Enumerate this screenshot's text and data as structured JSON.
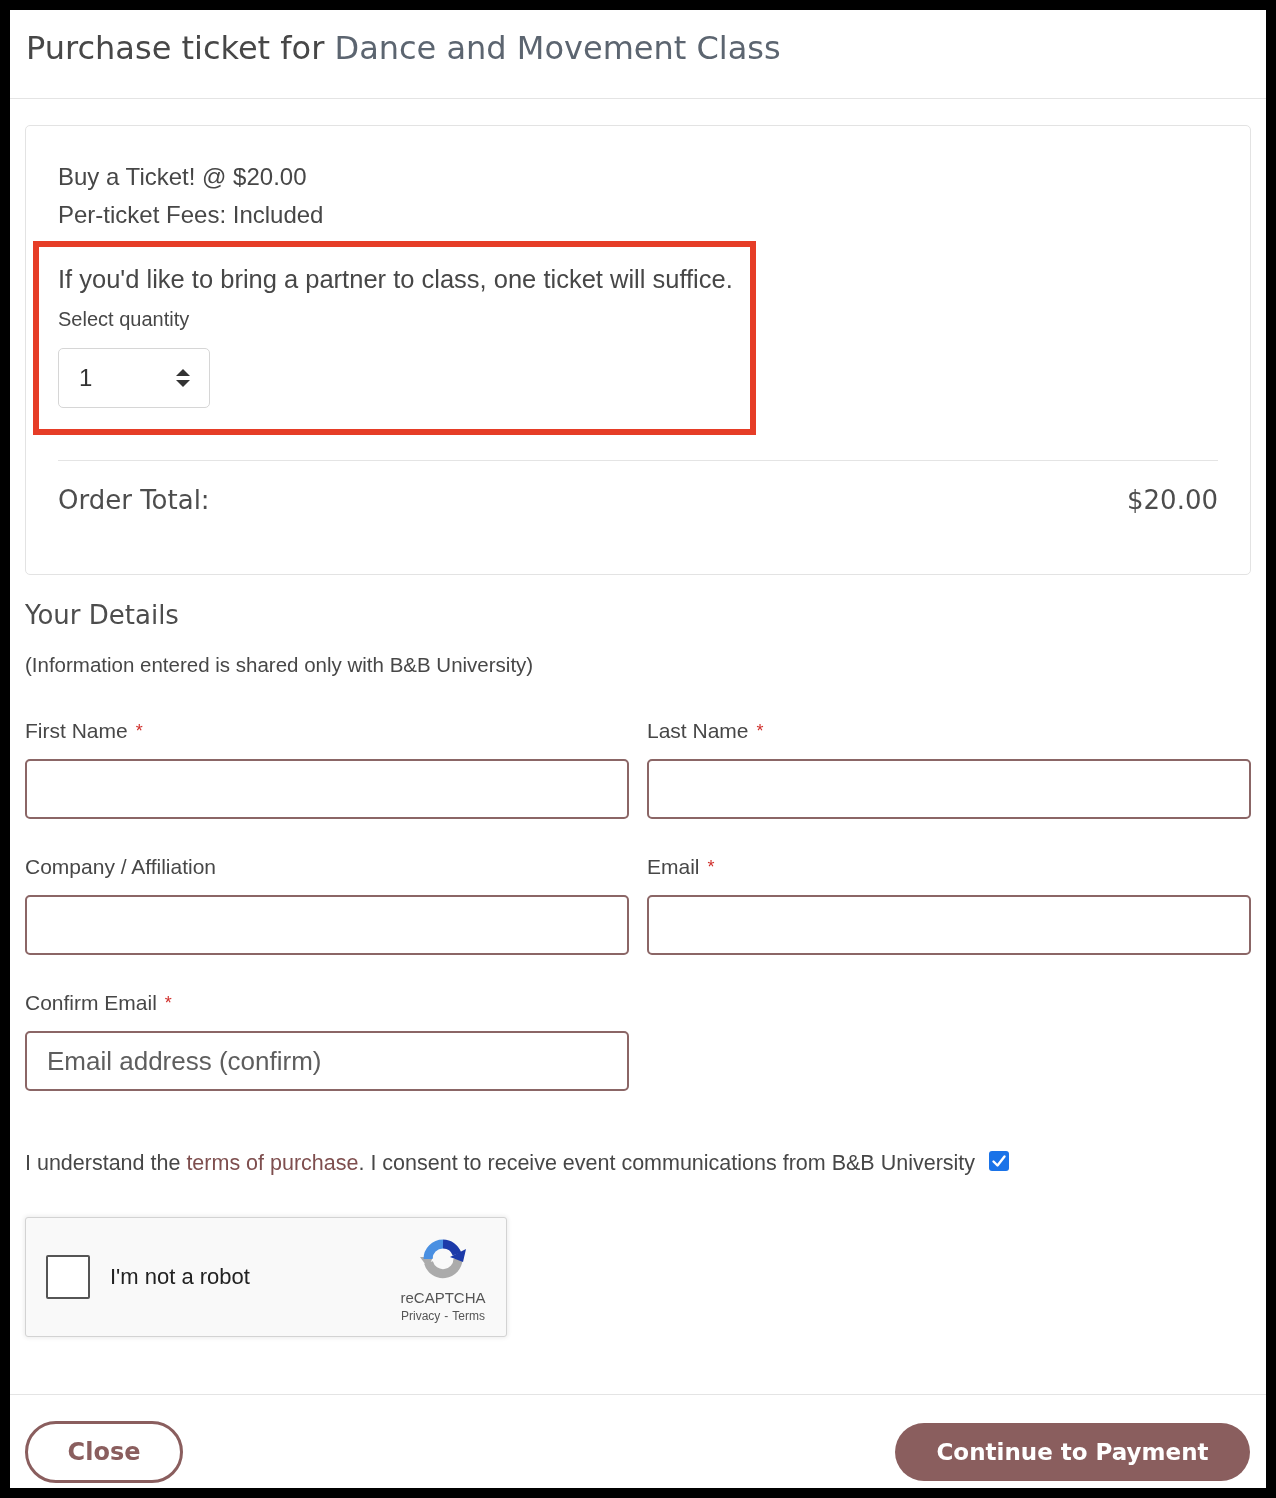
{
  "dialog": {
    "title_prefix": "Purchase ticket for",
    "event_name": "Dance and Movement Class"
  },
  "ticket": {
    "name_price": "Buy a Ticket! @ $20.00",
    "fees": "Per-ticket Fees: Included",
    "quantity_section": {
      "highlighted": true,
      "note": "If you'd like to bring a partner to class, one ticket will suffice.",
      "label": "Select quantity",
      "value": "1"
    },
    "order_total": {
      "label": "Order Total:",
      "value": "$20.00"
    }
  },
  "details": {
    "heading": "Your Details",
    "note": "(Information entered is shared only with B&B University)",
    "fields": [
      {
        "label": "First Name",
        "required_mark": "*"
      },
      {
        "label": "Last Name",
        "required_mark": "*"
      },
      {
        "label": "Company / Affiliation"
      },
      {
        "label": "Email",
        "required_mark": "*"
      },
      {
        "label": "Confirm Email",
        "required_mark": "*",
        "placeholder": "Email address (confirm)"
      }
    ]
  },
  "consent": {
    "text_before": "I understand the",
    "link": "terms of purchase",
    "text_after": ". I consent to receive event communications from B&B University",
    "checked": true
  },
  "captcha": {
    "label": "I'm not a robot",
    "checked": false,
    "brand": "reCAPTCHA",
    "links": [
      "Privacy",
      "Terms"
    ],
    "separator": "-"
  },
  "footer": {
    "buttons": [
      {
        "label": "Close",
        "kind": "outline"
      },
      {
        "label": "Continue to Payment",
        "kind": "filled"
      }
    ]
  }
}
